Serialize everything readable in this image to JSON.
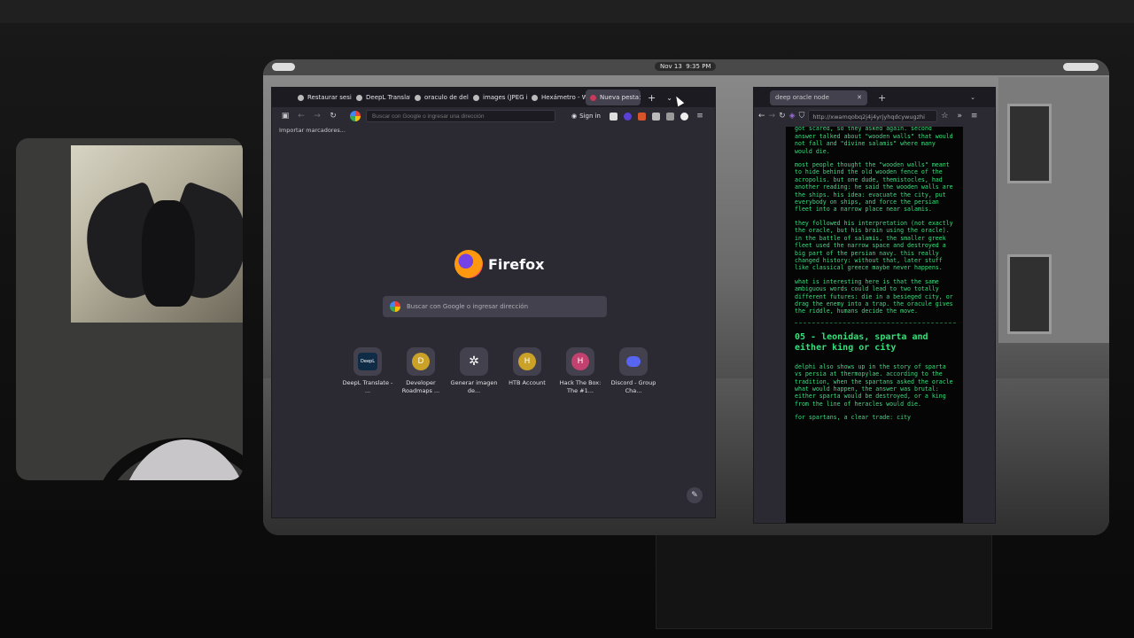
{
  "desktop": {
    "date": "Nov 13",
    "time": "9:35 PM"
  },
  "firefox": {
    "tabs": [
      {
        "label": "Restaurar sesió"
      },
      {
        "label": "DeepL Translat"
      },
      {
        "label": "oraculo de delf"
      },
      {
        "label": "images (JPEG ima"
      },
      {
        "label": "Hexámetro - W"
      },
      {
        "label": "Nueva pesta"
      }
    ],
    "url_placeholder": "Buscar con Google o ingresar una dirección",
    "signin_label": "Sign in",
    "bookmarks_import": "Importar marcadores...",
    "brand": "Firefox",
    "search_placeholder": "Buscar con Google o ingresar dirección",
    "shortcuts": [
      {
        "label": "DeepL Translate - ...",
        "letter": "DeepL",
        "color": "#0f2b46"
      },
      {
        "label": "Developer Roadmaps ...",
        "letter": "D",
        "color": "#c9a227"
      },
      {
        "label": "Generar imagen de...",
        "letter": "❀",
        "color": "#42414d"
      },
      {
        "label": "HTB Account",
        "letter": "H",
        "color": "#c9a227"
      },
      {
        "label": "Hack The Box: The #1...",
        "letter": "H",
        "color": "#c2416f"
      },
      {
        "label": "Discord - Group Cha...",
        "letter": "●",
        "color": "#42414d"
      }
    ]
  },
  "oracle_browser": {
    "tab_label": "deep oracle node",
    "url": "http://xwamqobq2j4j4yrjyhqdcywugzhi",
    "content": {
      "p0": "like \"your city will be destroyed\" athenians got scared, so they asked again. second answer talked about \"wooden walls\" that would not fall and \"divine salamis\" where many would die.",
      "p1": "most people thought the \"wooden walls\" meant to hide behind the old wooden fence of the acropolis. but one dude, themistocles, had another reading: he said the wooden walls are the ships. his idea: evacuate the city, put everybody on ships, and force the persian fleet into a narrow place near salamis.",
      "p2": "they followed his interpretation (not exactly the oracle, but his brain using the oracle). in the battle of salamis, the smaller greek fleet used the narrow space and destroyed a big part of the persian navy. this really changed history: without that, later stuff like classical greece maybe never happens.",
      "p3": "what is interesting here is that the same ambiguous words could lead to two totally different futures: die in a besieged city, or drag the enemy into a trap. the oracule gives the riddle, humans decide the move.",
      "heading": "05 - leonidas, sparta and either king or city",
      "p4": "delphi also shows up in the story of sparta vs persia at thermopylae. according to the tradition, when the spartans asked the oracle what would happen, the answer was brutal: either sparta would be destroyed, or a king from the line of heracles would die.",
      "p5": "for spartans, a clear trade: city"
    }
  }
}
